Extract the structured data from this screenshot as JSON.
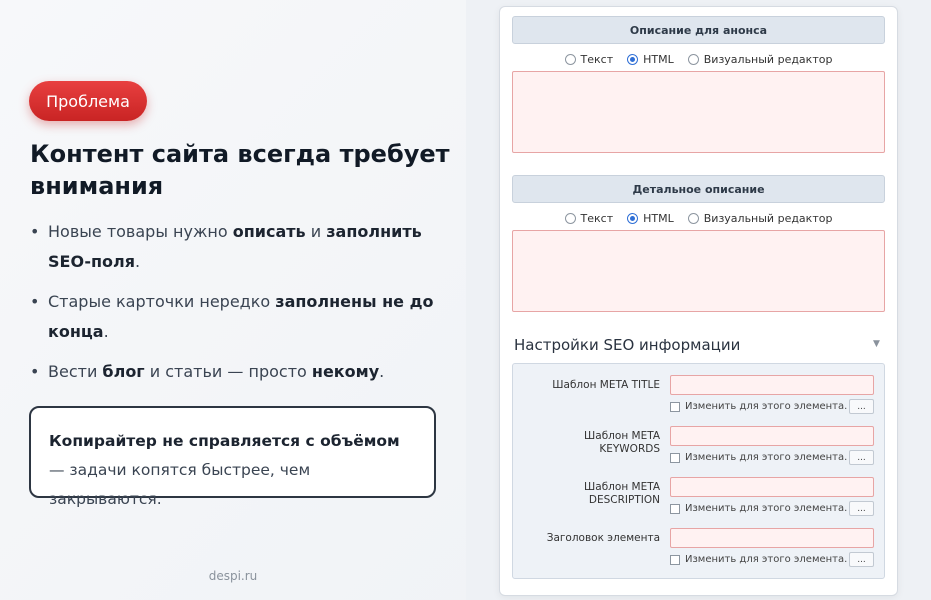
{
  "left": {
    "badge": "Проблема",
    "headline_line1": "Контент сайта всегда требует",
    "headline_line2": "внимания",
    "bullets": [
      {
        "t1": "Новые товары нужно ",
        "b1": "описать",
        "t2": " и ",
        "b2": "заполнить SEO-поля",
        "t3": "."
      },
      {
        "t1": "Старые карточки нередко ",
        "b1": "заполнены не до конца",
        "t2": ".",
        "b2": "",
        "t3": ""
      },
      {
        "t1": "Вести ",
        "b1": "блог",
        "t2": " и статьи — просто ",
        "b2": "некому",
        "t3": "."
      }
    ],
    "callout_bold": "Копирайтер не справляется с объёмом",
    "callout_rest": " — задачи копятся быстрее, чем закрываются.",
    "footer": "despi.ru"
  },
  "form": {
    "section1_title": "Описание для анонса",
    "section2_title": "Детальное описание",
    "radio_options": [
      "Текст",
      "HTML",
      "Визуальный редактор"
    ],
    "radio_selected": "HTML",
    "seo_title": "Настройки SEO информации",
    "seo_arrow": "▼",
    "seo_fields": [
      {
        "label": "Шаблон META TITLE"
      },
      {
        "label": "Шаблон META KEYWORDS"
      },
      {
        "label": "Шаблон META DESCRIPTION"
      },
      {
        "label": "Заголовок элемента"
      }
    ],
    "checkbox_label": "Изменить для этого элемента.",
    "dots_button": "..."
  },
  "colors": {
    "badge": "#d93030",
    "field_bg": "#fff2f2",
    "field_border": "#e7a5a5",
    "header_bg": "#dfe6ee"
  }
}
